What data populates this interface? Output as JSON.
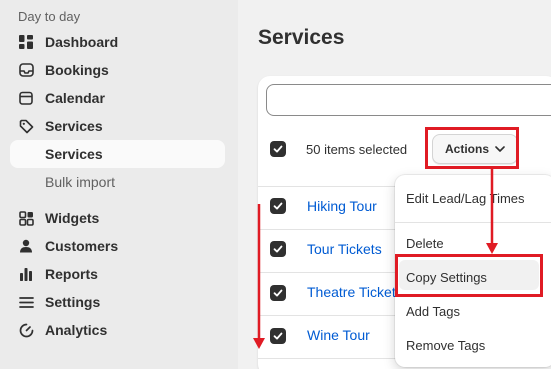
{
  "sidebar": {
    "section_title": "Day to day",
    "items": [
      {
        "label": "Dashboard",
        "icon": "dashboard-icon"
      },
      {
        "label": "Bookings",
        "icon": "inbox-icon"
      },
      {
        "label": "Calendar",
        "icon": "calendar-icon"
      },
      {
        "label": "Services",
        "icon": "tag-icon"
      },
      {
        "label": "Services",
        "icon": "none"
      },
      {
        "label": "Bulk import",
        "icon": "none"
      },
      {
        "label": "Widgets",
        "icon": "widgets-icon"
      },
      {
        "label": "Customers",
        "icon": "person-icon"
      },
      {
        "label": "Reports",
        "icon": "bar-chart-icon"
      },
      {
        "label": "Settings",
        "icon": "settings-icon"
      },
      {
        "label": "Analytics",
        "icon": "analytics-icon"
      }
    ]
  },
  "main": {
    "title": "Services",
    "search": {
      "placeholder": "",
      "value": ""
    },
    "selection_text": "50 items selected",
    "actions_label": "Actions",
    "rows": [
      {
        "name": "Hiking Tour"
      },
      {
        "name": "Tour Tickets"
      },
      {
        "name": "Theatre Tickets"
      },
      {
        "name": "Wine Tour"
      }
    ]
  },
  "actions_menu": {
    "items": [
      "Edit Lead/Lag Times",
      "Delete",
      "Copy Settings",
      "Add Tags",
      "Remove Tags"
    ],
    "highlighted": "Copy Settings"
  },
  "colors": {
    "annotation": "#e01b24",
    "link": "#005bd3",
    "sidebar_bg": "#ebebeb",
    "checkbox": "#303030"
  }
}
